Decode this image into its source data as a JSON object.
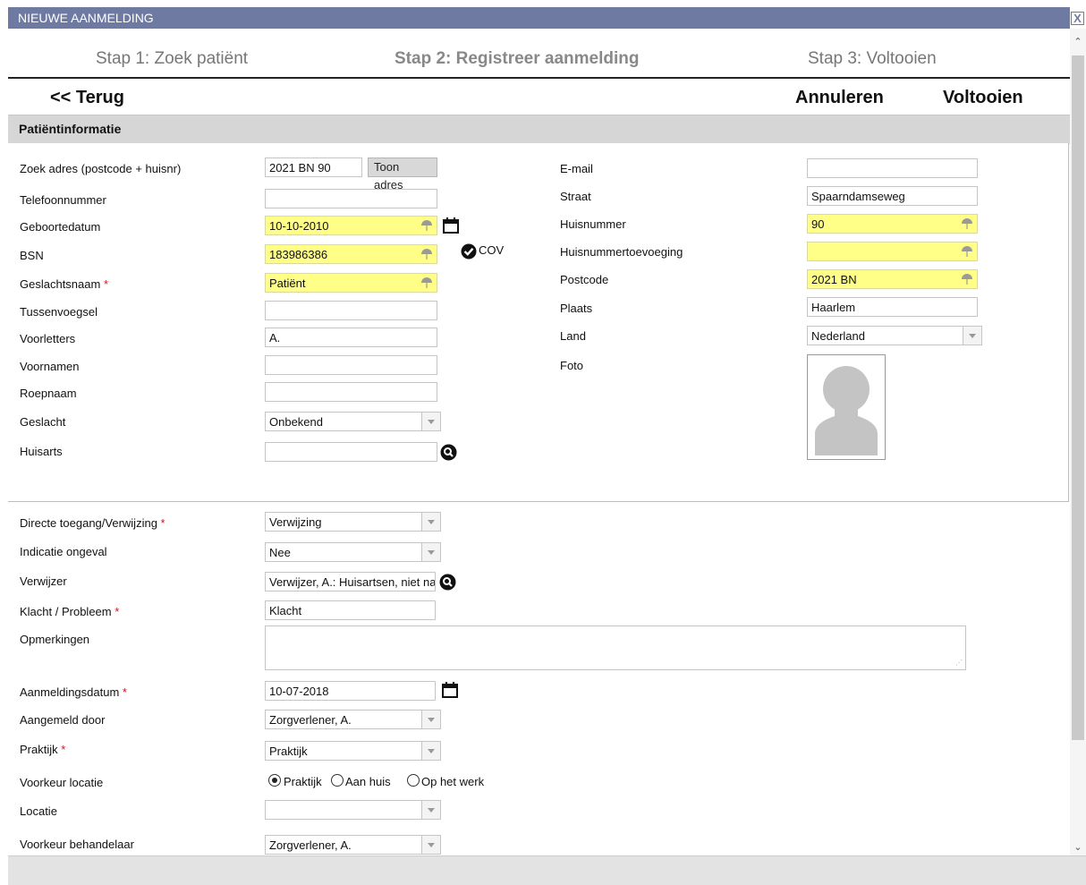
{
  "window": {
    "title": "NIEUWE AANMELDING",
    "close_label": "X"
  },
  "steps": [
    {
      "label": "Stap 1: Zoek patiënt"
    },
    {
      "label": "Stap 2: Registreer aanmelding"
    },
    {
      "label": "Stap 3: Voltooien"
    }
  ],
  "nav": {
    "back": "<< Terug",
    "cancel": "Annuleren",
    "finish": "Voltooien"
  },
  "section": {
    "title": "Patiëntinformatie"
  },
  "left": {
    "search_address": {
      "label": "Zoek adres (postcode + huisnr)",
      "value": "2021 BN 90",
      "button": "Toon adres"
    },
    "phone": {
      "label": "Telefoonnummer",
      "value": ""
    },
    "birthdate": {
      "label": "Geboortedatum",
      "value": "10-10-2010"
    },
    "bsn": {
      "label": "BSN",
      "value": "183986386",
      "cov": "COV"
    },
    "surname": {
      "label": "Geslachtsnaam",
      "value": "Patiënt",
      "required": "*"
    },
    "infix": {
      "label": "Tussenvoegsel",
      "value": ""
    },
    "initials": {
      "label": "Voorletters",
      "value": "A."
    },
    "firstnames": {
      "label": "Voornamen",
      "value": ""
    },
    "nickname": {
      "label": "Roepnaam",
      "value": ""
    },
    "gender": {
      "label": "Geslacht",
      "value": "Onbekend"
    },
    "gp": {
      "label": "Huisarts",
      "value": ""
    }
  },
  "right": {
    "email": {
      "label": "E-mail",
      "value": ""
    },
    "street": {
      "label": "Straat",
      "value": "Spaarndamseweg"
    },
    "housenumber": {
      "label": "Huisnummer",
      "value": "90"
    },
    "housenumber_add": {
      "label": "Huisnummertoevoeging",
      "value": ""
    },
    "postcode": {
      "label": "Postcode",
      "value": "2021 BN"
    },
    "city": {
      "label": "Plaats",
      "value": "Haarlem"
    },
    "country": {
      "label": "Land",
      "value": "Nederland"
    },
    "photo": {
      "label": "Foto"
    }
  },
  "referral": {
    "access": {
      "label": "Directe toegang/Verwijzing",
      "value": "Verwijzing",
      "required": "*"
    },
    "accident": {
      "label": "Indicatie ongeval",
      "value": "Nee"
    },
    "referrer": {
      "label": "Verwijzer",
      "value": "Verwijzer, A.: Huisartsen, niet nader gespecificeerd"
    },
    "complaint": {
      "label": "Klacht / Probleem",
      "value": "Klacht",
      "required": "*"
    },
    "remarks": {
      "label": "Opmerkingen",
      "value": ""
    },
    "reg_date": {
      "label": "Aanmeldingsdatum",
      "value": "10-07-2018",
      "required": "*"
    },
    "registered_by": {
      "label": "Aangemeld door",
      "value": "Zorgverlener, A."
    },
    "practice": {
      "label": "Praktijk",
      "value": "Praktijk",
      "required": "*"
    },
    "location_pref": {
      "label": "Voorkeur locatie",
      "options": [
        "Praktijk",
        "Aan huis",
        "Op het werk"
      ],
      "selected": "Praktijk"
    },
    "location": {
      "label": "Locatie",
      "value": ""
    },
    "practitioner_pref": {
      "label": "Voorkeur behandelaar",
      "value": "Zorgverlener, A."
    }
  },
  "colors": {
    "titlebar": "#6e7aa2",
    "highlight_field": "#ffff88",
    "section_header": "#d6d6d6",
    "required": "#dd1111"
  }
}
